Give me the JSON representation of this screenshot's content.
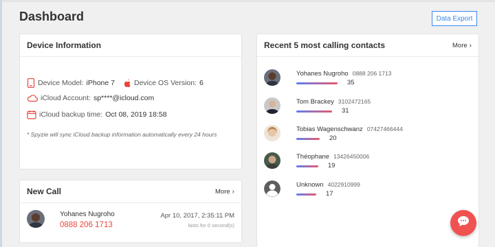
{
  "page": {
    "title": "Dashboard",
    "export_label": "Data Export"
  },
  "device": {
    "title": "Device Information",
    "model_label": "Device Model:",
    "model_value": "iPhone 7",
    "os_label": "Device OS Version:",
    "os_value": "6",
    "icloud_label": "iCloud Account:",
    "icloud_value": "sp****@icloud.com",
    "backup_label": "iCloud backup time:",
    "backup_value": "Oct 08, 2019 18:58",
    "note": "* Spyzie will sync iCloud backup information automatically every 24 hours"
  },
  "new_call": {
    "title": "New Call",
    "more_label": "More",
    "name": "Yohanes Nugroho",
    "number": "0888 206 1713",
    "time": "Apr 10, 2017, 2:35:11 PM",
    "duration": "lasts for 0 second(s)"
  },
  "contacts": {
    "title": "Recent 5 most calling contacts",
    "more_label": "More",
    "items": [
      {
        "name": "Yohanes Nugroho",
        "phone": "0888 206 1713",
        "count": "35"
      },
      {
        "name": "Tom Brackey",
        "phone": "3102472165",
        "count": "31"
      },
      {
        "name": "Tobias Wagenschwanz",
        "phone": "07427466444",
        "count": "20"
      },
      {
        "name": "Théophane",
        "phone": "13426450006",
        "count": "19"
      },
      {
        "name": "Unknown",
        "phone": "4022910999",
        "count": "17"
      }
    ]
  },
  "colors": {
    "accent": "#3b86f0",
    "alert": "#e8453c",
    "fab": "#f05252"
  },
  "icons": [
    "phone-icon",
    "apple-icon",
    "cloud-icon",
    "calendar-icon",
    "chat-icon",
    "chevron-right-icon"
  ]
}
